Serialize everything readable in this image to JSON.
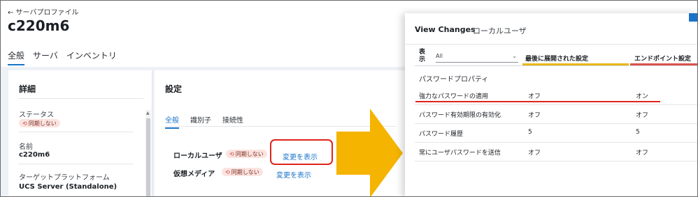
{
  "profile": {
    "back_link": "← サーバプロファイル",
    "title": "c220m6",
    "tabs": [
      "全般",
      "サーバ",
      "インベントリ"
    ]
  },
  "details": {
    "heading": "詳細",
    "fields": [
      {
        "label": "ステータス",
        "badge": "同期しない"
      },
      {
        "label": "名前",
        "value": "c220m6"
      },
      {
        "label": "ターゲットプラットフォーム",
        "value": "UCS Server (Standalone)"
      }
    ]
  },
  "settings": {
    "heading": "設定",
    "tabs": [
      "全般",
      "識別子",
      "接続性"
    ],
    "rows": [
      {
        "label": "ローカルユーザ",
        "badge": "同期しない",
        "link": "変更を表示"
      },
      {
        "label": "仮想メディア",
        "badge": "同期しない",
        "link": "変更を表示"
      }
    ]
  },
  "panel": {
    "title": "View Changes",
    "subtitle": "ローカルユーザ",
    "filter_label": "表示",
    "filter_value": "All",
    "columns": [
      "最後に展開された設定",
      "エンドポイント設定"
    ],
    "group": "パスワードプロパティ",
    "rows": [
      {
        "name": "強力なパスワードの適用",
        "deployed": "オフ",
        "endpoint": "オン"
      },
      {
        "name": "パスワード有効期限の有効化",
        "deployed": "オフ",
        "endpoint": "オフ"
      },
      {
        "name": "パスワード履歴",
        "deployed": "5",
        "endpoint": "5"
      },
      {
        "name": "常にユーザパスワードを送信",
        "deployed": "オフ",
        "endpoint": "オフ"
      }
    ]
  },
  "colors": {
    "accent": "#1a73c9",
    "highlight": "#e0231b",
    "arrow": "#f5b400",
    "badge_bg": "#fbe3df",
    "deployed_bar": "#e8b81a",
    "endpoint_bar": "#d9534f"
  }
}
